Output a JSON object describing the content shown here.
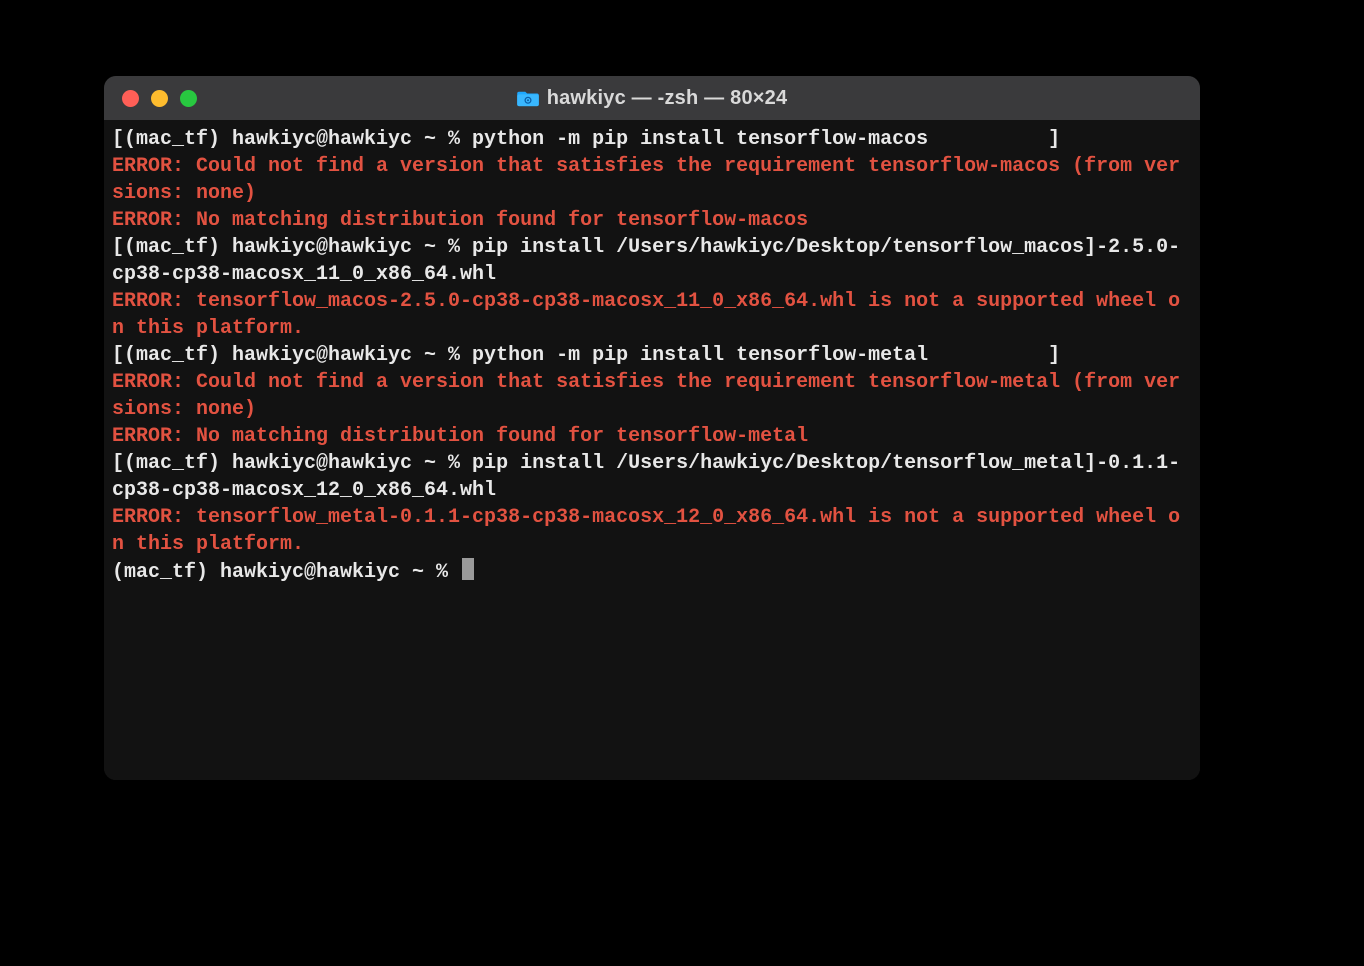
{
  "window": {
    "title": "hawkiyc — -zsh — 80×24"
  },
  "colors": {
    "error": "#e25241",
    "text": "#e8e8e8",
    "window_bg": "#1e1e1e",
    "body_bg": "#121212",
    "titlebar_bg": "#3a3a3c"
  },
  "terminal": {
    "lines": [
      {
        "cls": "normal",
        "text": "[(mac_tf) hawkiyc@hawkiyc ~ % python -m pip install tensorflow-macos          ]"
      },
      {
        "cls": "err",
        "text": "ERROR: Could not find a version that satisfies the requirement tensorflow-macos (from versions: none)"
      },
      {
        "cls": "err",
        "text": "ERROR: No matching distribution found for tensorflow-macos"
      },
      {
        "cls": "normal",
        "text": "[(mac_tf) hawkiyc@hawkiyc ~ % pip install /Users/hawkiyc/Desktop/tensorflow_macos]-2.5.0-cp38-cp38-macosx_11_0_x86_64.whl"
      },
      {
        "cls": "err",
        "text": "ERROR: tensorflow_macos-2.5.0-cp38-cp38-macosx_11_0_x86_64.whl is not a supported wheel on this platform."
      },
      {
        "cls": "normal",
        "text": "[(mac_tf) hawkiyc@hawkiyc ~ % python -m pip install tensorflow-metal          ]"
      },
      {
        "cls": "err",
        "text": "ERROR: Could not find a version that satisfies the requirement tensorflow-metal (from versions: none)"
      },
      {
        "cls": "err",
        "text": "ERROR: No matching distribution found for tensorflow-metal"
      },
      {
        "cls": "normal",
        "text": "[(mac_tf) hawkiyc@hawkiyc ~ % pip install /Users/hawkiyc/Desktop/tensorflow_metal]-0.1.1-cp38-cp38-macosx_12_0_x86_64.whl"
      },
      {
        "cls": "err",
        "text": "ERROR: tensorflow_metal-0.1.1-cp38-cp38-macosx_12_0_x86_64.whl is not a supported wheel on this platform."
      }
    ],
    "prompt": "(mac_tf) hawkiyc@hawkiyc ~ % "
  }
}
